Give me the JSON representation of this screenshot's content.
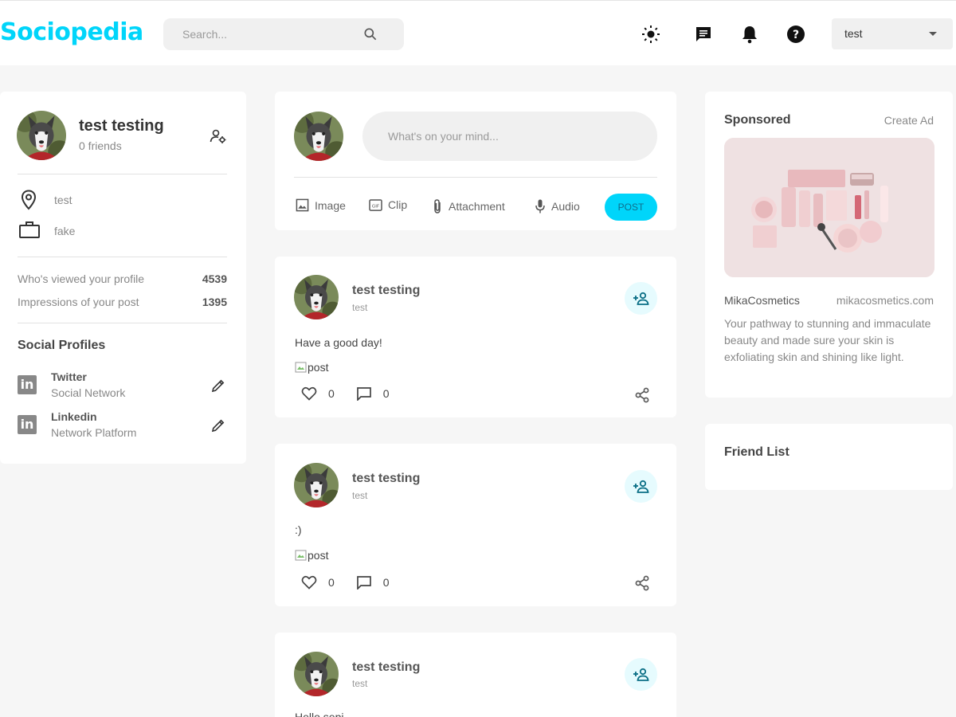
{
  "navbar": {
    "brand": "Sociopedia",
    "search_placeholder": "Search...",
    "user_select": "test",
    "icons": [
      "sun-icon",
      "message-icon",
      "notification-bell-icon",
      "help-icon"
    ]
  },
  "user_widget": {
    "name": "test testing",
    "friends": "0 friends",
    "location": "test",
    "occupation": "fake",
    "stats": [
      {
        "label": "Who's viewed your profile",
        "value": "4539"
      },
      {
        "label": "Impressions of your post",
        "value": "1395"
      }
    ],
    "social_title": "Social Profiles",
    "social_profiles": [
      {
        "name": "Twitter",
        "sub": "Social Network"
      },
      {
        "name": "Linkedin",
        "sub": "Network Platform"
      }
    ]
  },
  "composer": {
    "placeholder": "What's on your mind...",
    "tools": [
      "Image",
      "Clip",
      "Attachment",
      "Audio"
    ],
    "post_button": "POST"
  },
  "posts": [
    {
      "name": "test testing",
      "location": "test",
      "description": "Have a good day!",
      "image_alt": "post",
      "likes": "0",
      "comments": "0"
    },
    {
      "name": "test testing",
      "location": "test",
      "description": ":)",
      "image_alt": "post",
      "likes": "0",
      "comments": "0"
    },
    {
      "name": "test testing",
      "location": "test",
      "description": "Hello sepi…"
    }
  ],
  "advert": {
    "title": "Sponsored",
    "create_ad": "Create Ad",
    "brand": "MikaCosmetics",
    "site": "mikacosmetics.com",
    "description": "Your pathway to stunning and immaculate beauty and made sure your skin is exfoliating skin and shining like light."
  },
  "friend_list": {
    "title": "Friend List"
  },
  "colors": {
    "primary": "#00d5fa",
    "primary_light": "#e6fbfe",
    "background": "#f6f6f6"
  }
}
